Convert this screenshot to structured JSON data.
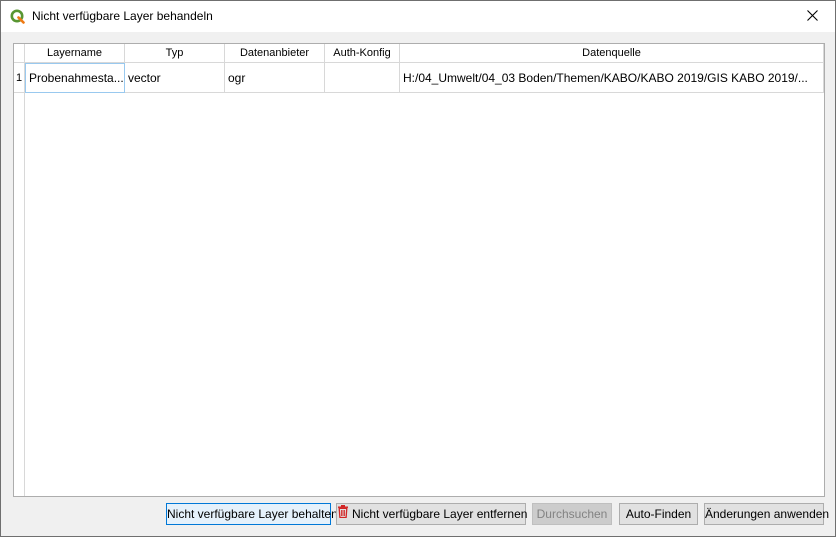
{
  "window": {
    "title": "Nicht verfügbare Layer behandeln",
    "app_icon": "qgis-icon",
    "close_icon": "close-icon"
  },
  "table": {
    "columns": [
      "Layername",
      "Typ",
      "Datenanbieter",
      "Auth-Konfig",
      "Datenquelle"
    ],
    "rows": [
      {
        "number": "1",
        "layername": "Probenahmesta...",
        "typ": "vector",
        "datenanbieter": "ogr",
        "auth_konfig": "",
        "datenquelle": "H:/04_Umwelt/04_03 Boden/Themen/KABO/KABO 2019/GIS KABO 2019/..."
      }
    ]
  },
  "buttons": {
    "keep": "Nicht verfügbare Layer behalten",
    "remove": "Nicht verfügbare Layer entfernen",
    "browse": "Durchsuchen",
    "auto_find": "Auto-Finden",
    "apply": "Änderungen anwenden"
  },
  "colors": {
    "qgis_green": "#589632",
    "remove_red": "#d22424",
    "default_button_border": "#0078d7"
  }
}
